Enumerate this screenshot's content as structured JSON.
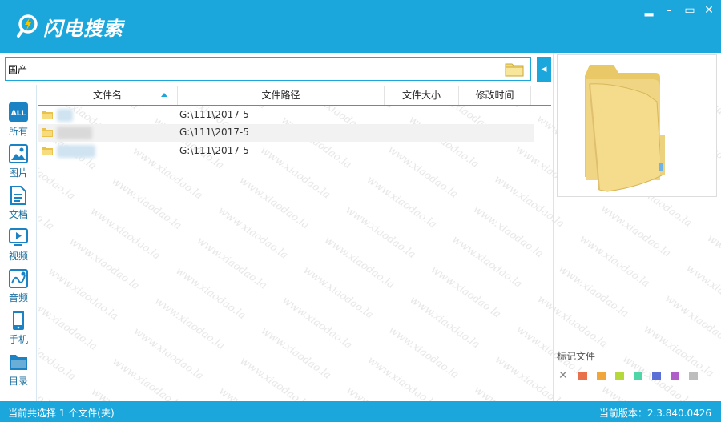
{
  "app": {
    "title": "闪电搜索"
  },
  "window": {
    "minimize": "▂",
    "restore": "▭",
    "close": "✕"
  },
  "search": {
    "value": "国产"
  },
  "sidebar": {
    "items": [
      {
        "label": "所有",
        "icon": "all-icon"
      },
      {
        "label": "图片",
        "icon": "image-icon"
      },
      {
        "label": "文档",
        "icon": "document-icon"
      },
      {
        "label": "视频",
        "icon": "video-icon"
      },
      {
        "label": "音频",
        "icon": "audio-icon"
      },
      {
        "label": "手机",
        "icon": "phone-icon"
      },
      {
        "label": "目录",
        "icon": "folder-icon"
      }
    ]
  },
  "table": {
    "columns": [
      "文件名",
      "文件路径",
      "文件大小",
      "修改时间"
    ],
    "rows": [
      {
        "path": "G:\\111\\2017-5"
      },
      {
        "path": "G:\\111\\2017-5"
      },
      {
        "path": "G:\\111\\2017-5"
      }
    ]
  },
  "tags": {
    "label": "标记文件",
    "colors": [
      "#e8704a",
      "#f0a63a",
      "#b5d93a",
      "#4fd6a8",
      "#5b6fd6",
      "#b05fc8",
      "#bdbdbd"
    ]
  },
  "status": {
    "left": "当前共选择 1 个文件(夹)",
    "right": "当前版本：2.3.840.0426"
  },
  "watermark": {
    "text": "www.xiaodao.la"
  },
  "colors": {
    "accent": "#1ba7dc"
  }
}
